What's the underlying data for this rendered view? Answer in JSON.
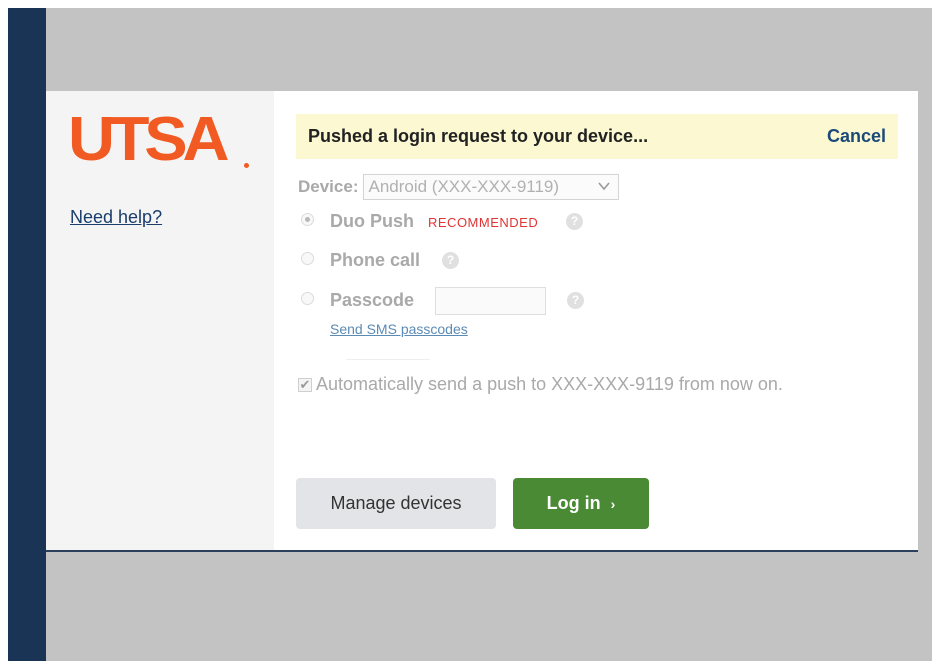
{
  "brand": {
    "logo_text": "UTSA",
    "accent_color": "#f15a22",
    "navy_color": "#1a3456"
  },
  "sidebar": {
    "help_link": "Need help?"
  },
  "notice": {
    "message": "Pushed a login request to your device...",
    "cancel_label": "Cancel"
  },
  "device": {
    "label": "Device:",
    "selected": "Android (XXX-XXX-9119)",
    "chevron_icon": "chevron-down-icon"
  },
  "auth_options": {
    "duo_push": {
      "label": "Duo Push",
      "badge": "RECOMMENDED",
      "selected": true
    },
    "phone_call": {
      "label": "Phone call",
      "selected": false
    },
    "passcode": {
      "label": "Passcode",
      "selected": false,
      "value": "",
      "sms_link": "Send SMS passcodes"
    },
    "help_icon_glyph": "?"
  },
  "auto_push": {
    "checked": true,
    "check_glyph": "✔",
    "text": "Automatically send a push to XXX-XXX-9119 from now on."
  },
  "buttons": {
    "manage_devices": "Manage devices",
    "log_in": "Log in",
    "log_in_arrow": "›",
    "log_in_color": "#4b8a35"
  }
}
